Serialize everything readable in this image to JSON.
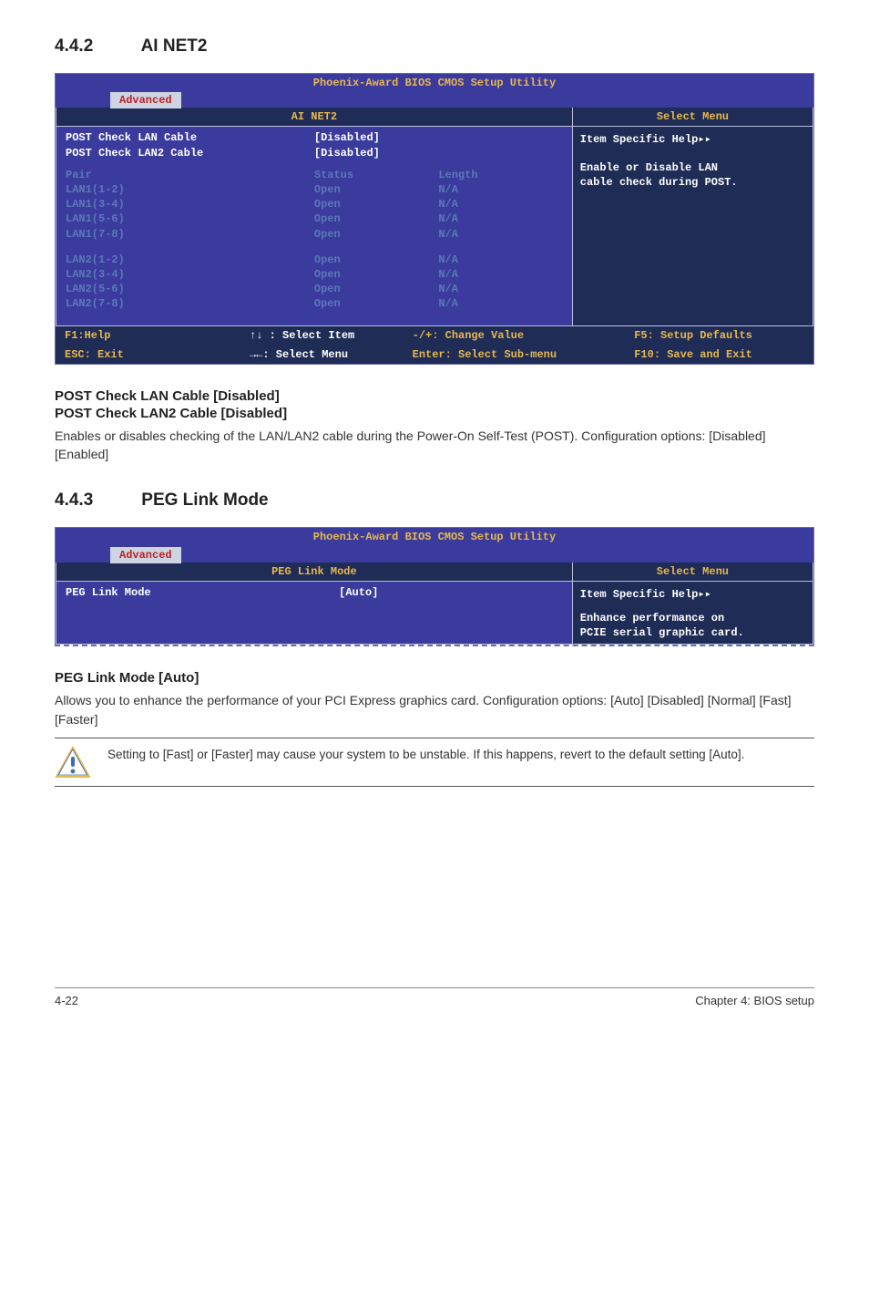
{
  "sec1": {
    "num": "4.4.2",
    "title": "AI NET2",
    "bios": {
      "title": "Phoenix-Award BIOS CMOS Setup Utility",
      "tab": "Advanced",
      "panel_title": "AI NET2",
      "right_header": "Select Menu",
      "rows_enabled": [
        {
          "a": "POST Check LAN Cable",
          "b": "[Disabled]",
          "c": ""
        },
        {
          "a": "POST Check LAN2 Cable",
          "b": "[Disabled]",
          "c": ""
        }
      ],
      "rows_dim_header": {
        "a": "Pair",
        "b": "Status",
        "c": "Length"
      },
      "rows_dim1": [
        {
          "a": "LAN1(1-2)",
          "b": "Open",
          "c": "N/A"
        },
        {
          "a": "LAN1(3-4)",
          "b": "Open",
          "c": "N/A"
        },
        {
          "a": "LAN1(5-6)",
          "b": "Open",
          "c": "N/A"
        },
        {
          "a": "LAN1(7-8)",
          "b": "Open",
          "c": "N/A"
        }
      ],
      "rows_dim2": [
        {
          "a": "LAN2(1-2)",
          "b": "Open",
          "c": "N/A"
        },
        {
          "a": "LAN2(3-4)",
          "b": "Open",
          "c": "N/A"
        },
        {
          "a": "LAN2(5-6)",
          "b": "Open",
          "c": "N/A"
        },
        {
          "a": "LAN2(7-8)",
          "b": "Open",
          "c": "N/A"
        }
      ],
      "help_line1": "Item Specific Help▸▸",
      "help_line2a": "Enable or Disable LAN",
      "help_line2b": "cable check during POST.",
      "footer": {
        "f1a": "F1:Help",
        "f1b": "↑↓ : Select Item",
        "f1c": "-/+: Change Value",
        "f1d": "F5: Setup Defaults",
        "f2a": "ESC: Exit",
        "f2b": "→←: Select Menu",
        "f2c": "Enter: Select Sub-menu",
        "f2d": "F10: Save and Exit"
      }
    },
    "cfg_head1": "POST Check LAN Cable  [Disabled]",
    "cfg_head2": "POST Check LAN2 Cable [Disabled]",
    "cfg_body": "Enables or disables checking of the LAN/LAN2 cable during the Power-On Self-Test (POST). Configuration options: [Disabled] [Enabled]"
  },
  "sec2": {
    "num": "4.4.3",
    "title": "PEG Link Mode",
    "bios": {
      "title": "Phoenix-Award BIOS CMOS Setup Utility",
      "tab": "Advanced",
      "panel_title": "PEG Link Mode",
      "right_header": "Select Menu",
      "row": {
        "a": "PEG Link Mode",
        "b": "[Auto]"
      },
      "help_line1": "Item Specific Help▸▸",
      "help_line2a": "Enhance performance on",
      "help_line2b": "PCIE serial graphic card."
    },
    "cfg_head": "PEG Link Mode  [Auto]",
    "cfg_body": "Allows you to enhance the performance of your PCI Express graphics card. Configuration options: [Auto] [Disabled] [Normal] [Fast] [Faster]",
    "note": "Setting to [Fast] or [Faster] may cause your system to be unstable. If this happens, revert to the default setting [Auto]."
  },
  "footer": {
    "left": "4-22",
    "right": "Chapter 4: BIOS setup"
  }
}
